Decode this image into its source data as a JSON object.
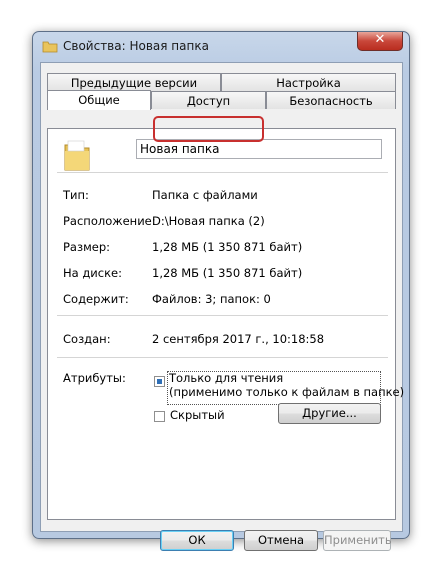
{
  "window": {
    "title": "Свойства: Новая папка",
    "close_glyph": "✕"
  },
  "tabs": {
    "row1": [
      "Предыдущие версии",
      "Настройка"
    ],
    "row2": [
      "Общие",
      "Доступ",
      "Безопасность"
    ],
    "active": "Общие",
    "highlighted": "Доступ"
  },
  "general": {
    "folder_name": "Новая папка",
    "fields": [
      {
        "label": "Тип:",
        "value": "Папка с файлами"
      },
      {
        "label": "Расположение:",
        "value": "D:\\Новая папка (2)"
      },
      {
        "label": "Размер:",
        "value": "1,28 МБ (1 350 871 байт)"
      },
      {
        "label": "На диске:",
        "value": "1,28 МБ (1 350 871 байт)"
      },
      {
        "label": "Содержит:",
        "value": "Файлов: 3; папок: 0"
      },
      {
        "label": "Создан:",
        "value": "2 сентября 2017 г., 10:18:58"
      }
    ],
    "attributes_label": "Атрибуты:",
    "readonly_line1": "Только для чтения",
    "readonly_line2": "(применимо только к файлам в папке)",
    "hidden_label": "Скрытый",
    "other_button": "Другие..."
  },
  "footer": {
    "ok": "ОК",
    "cancel": "Отмена",
    "apply": "Применить"
  },
  "colors": {
    "highlight": "#c8302f",
    "close_button": "#c9473a",
    "default_button_border": "#3c7fb1"
  }
}
